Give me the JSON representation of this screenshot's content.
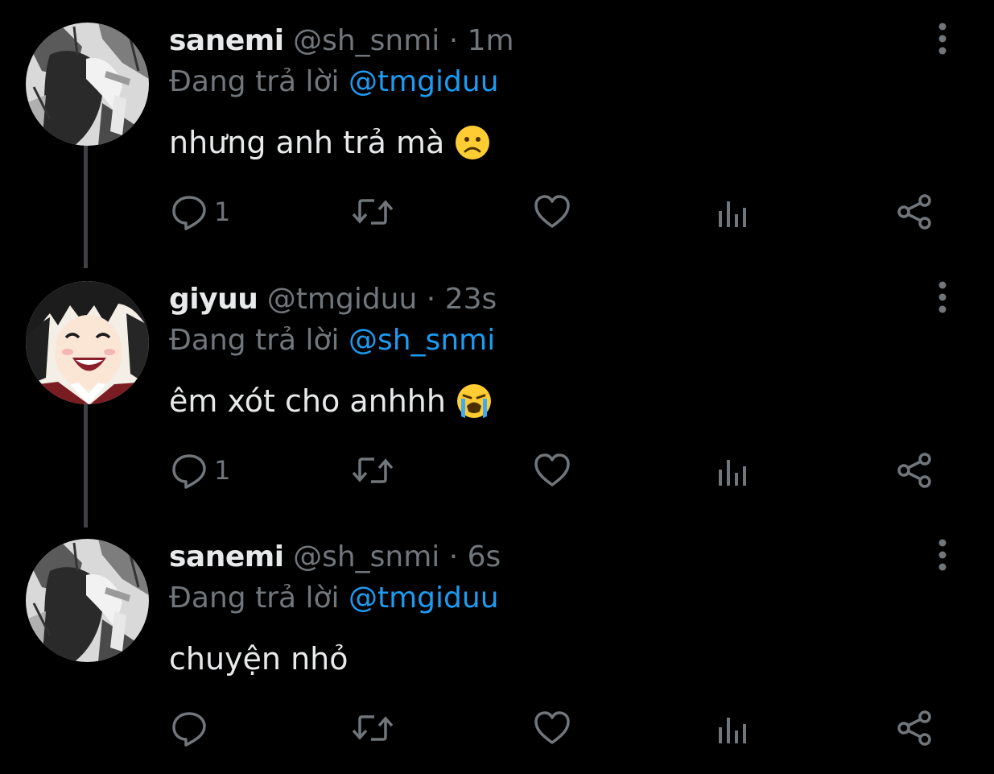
{
  "colors": {
    "background": "#000000",
    "text_primary": "#e7e9ea",
    "text_secondary": "#71767b",
    "accent": "#1d9bf0",
    "thread_line": "#3e4144"
  },
  "replying_prefix": "Đang trả lời",
  "tweets": [
    {
      "display_name": "sanemi",
      "handle": "@sh_snmi",
      "separator": "·",
      "time": "1m",
      "replying_to": "@tmgiduu",
      "text": "nhưng anh trả mà",
      "emoji": "slightly-frowning-face",
      "avatar": "sanemi-avatar",
      "reply_count": "1"
    },
    {
      "display_name": "giyuu",
      "handle": "@tmgiduu",
      "separator": "·",
      "time": "23s",
      "replying_to": "@sh_snmi",
      "text": "êm xót cho anhhh",
      "emoji": "loudly-crying-face",
      "avatar": "giyuu-avatar",
      "reply_count": "1"
    },
    {
      "display_name": "sanemi",
      "handle": "@sh_snmi",
      "separator": "·",
      "time": "6s",
      "replying_to": "@tmgiduu",
      "text": "chuyện nhỏ",
      "emoji": "",
      "avatar": "sanemi-avatar",
      "reply_count": ""
    }
  ],
  "action_icons": [
    "reply-icon",
    "retweet-icon",
    "like-icon",
    "views-icon",
    "share-icon"
  ],
  "more_icon": "more-vertical-icon"
}
